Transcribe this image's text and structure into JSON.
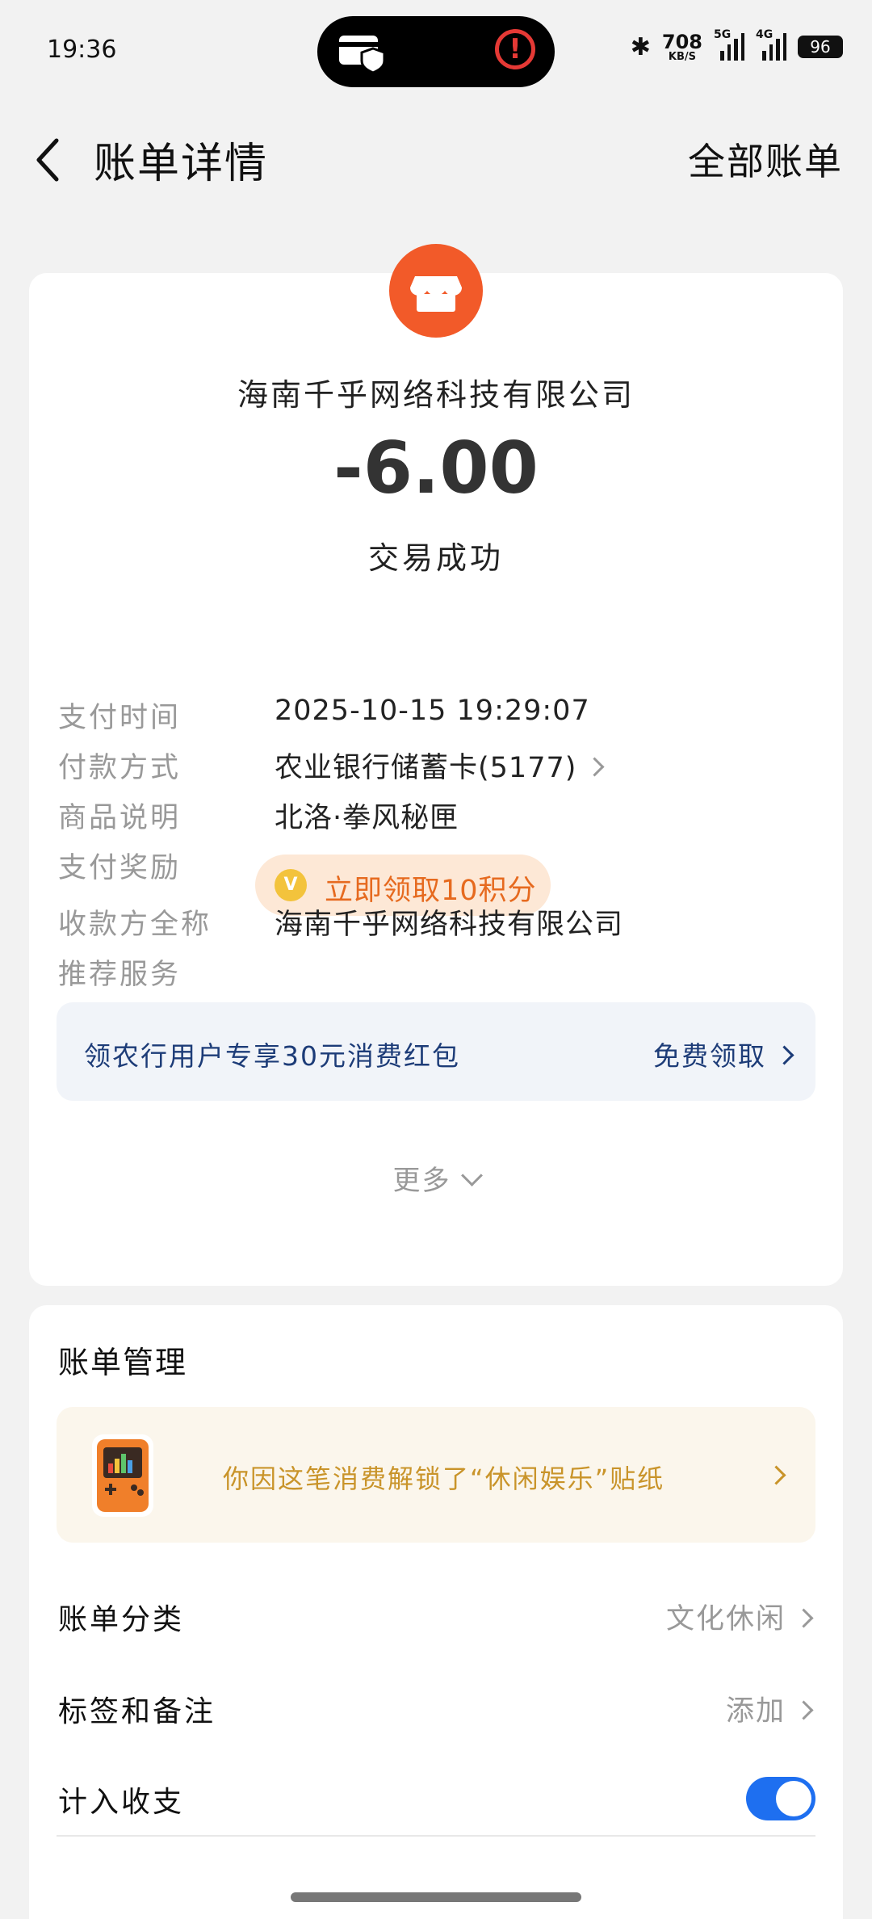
{
  "status_bar": {
    "time": "19:36",
    "net_speed": "708",
    "net_unit": "KB/S",
    "signal1": "5G",
    "signal2": "4G",
    "battery": "96"
  },
  "header": {
    "title": "账单详情",
    "right_link": "全部账单"
  },
  "bill": {
    "merchant": "海南千乎网络科技有限公司",
    "amount": "-6.00",
    "status": "交易成功",
    "rows": [
      {
        "label": "支付时间",
        "value": "2025-10-15 19:29:07"
      },
      {
        "label": "付款方式",
        "value": "农业银行储蓄卡(5177)"
      },
      {
        "label": "商品说明",
        "value": "北洛·拳风秘匣"
      },
      {
        "label": "支付奖励",
        "value": "立即领取10积分"
      },
      {
        "label": "收款方全称",
        "value": "海南千乎网络科技有限公司"
      },
      {
        "label": "推荐服务",
        "value": ""
      }
    ],
    "promo": {
      "text": "领农行用户专享30元消费红包",
      "action": "免费领取"
    },
    "more": "更多"
  },
  "management": {
    "title": "账单管理",
    "sticker_text": "你因这笔消费解锁了“休闲娱乐”贴纸",
    "category_label": "账单分类",
    "category_value": "文化休闲",
    "tags_label": "标签和备注",
    "tags_value": "添加",
    "include_label": "计入收支",
    "include_on": true
  },
  "colors": {
    "accent": "#1e6ff0",
    "store_icon": "#f25a29",
    "reward_text": "#e66a1f",
    "promo_text": "#1d3c78",
    "sticker_text": "#c9942a"
  }
}
